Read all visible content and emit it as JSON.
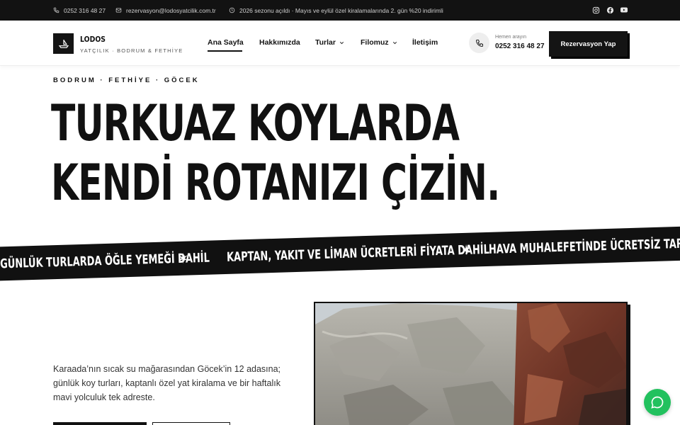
{
  "topbar": {
    "phone": "0252 316 48 27",
    "email": "rezervasyon@lodosyatcilik.com.tr",
    "announcement": "2026 sezonu açıldı · Mayıs ve eylül özel kiralamalarında 2. gün %20 indirimli",
    "social": [
      "instagram-icon",
      "facebook-icon",
      "youtube-icon"
    ]
  },
  "header": {
    "logo_name": "LODOS",
    "logo_sub": "YATÇILIK · BODRUM & FETHİYE",
    "nav": [
      {
        "label": "Ana Sayfa",
        "active": true
      },
      {
        "label": "Hakkımızda"
      },
      {
        "label": "Turlar",
        "dropdown": true
      },
      {
        "label": "Filomuz",
        "dropdown": true
      },
      {
        "label": "İletişim"
      }
    ],
    "phone_caption": "Hemen arayın",
    "phone_number": "0252 316 48 27",
    "reserve_label": "Rezervasyon Yap"
  },
  "hero": {
    "eyebrow": "BODRUM · FETHİYE · GÖCEK",
    "title_line1": "TURKUAZ KOYLARDA",
    "title_line2": "KENDİ ROTANIZI ÇİZİN."
  },
  "ticker": {
    "items": [
      "GÜNLÜK TURLARDA ÖĞLE YEMEĞİ DAHİL",
      "KAPTAN, YAKIT VE LİMAN ÜCRETLERİ FİYATA DAHİL",
      "HAVA MUHALEFETİNDE ÜCRETSİZ TARİH DEĞİŞİKLİĞİ"
    ],
    "separator": "✶"
  },
  "intro": {
    "text": "Karaada’nın sıcak su mağarasından Göcek’in 12 adasına; günlük koy turları, kaptanlı özel yat kiralama ve bir haftalık mavi yolculuk tek adreste."
  },
  "colors": {
    "dark": "#121212",
    "whatsapp": "#22c15e"
  }
}
